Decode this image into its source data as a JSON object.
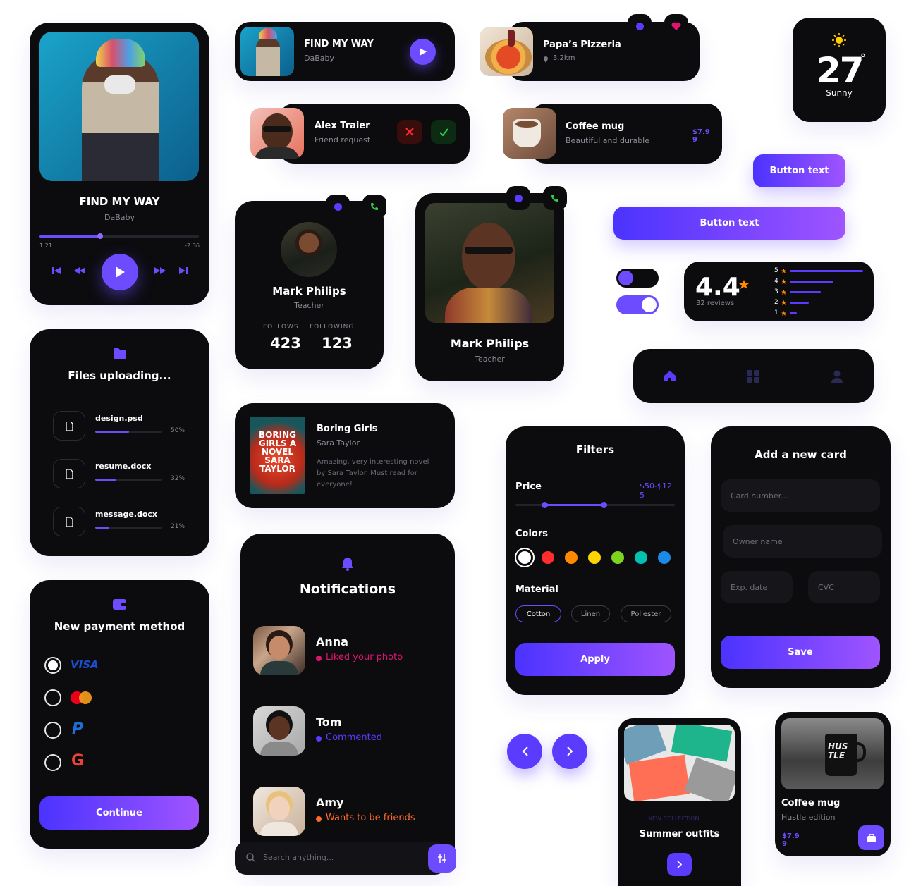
{
  "player": {
    "title": "FIND MY WAY",
    "artist": "DaBaby",
    "elapsed": "1:21",
    "remaining": "-2:36",
    "progress": 0.38
  },
  "mini_player": {
    "title": "FIND MY WAY",
    "artist": "DaBaby"
  },
  "pizzeria": {
    "name": "Papa’s Pizzeria",
    "distance": "3.2km"
  },
  "weather": {
    "temp": "27",
    "deg": "°",
    "condition": "Sunny"
  },
  "friend_request": {
    "name": "Alex Traier",
    "subtitle": "Friend request"
  },
  "coffee_row": {
    "name": "Coffee mug",
    "subtitle": "Beautiful and durable",
    "price": "$7.9\n9"
  },
  "buttons": {
    "small": "Button text",
    "wide": "Button text"
  },
  "profile_small": {
    "name": "Mark Philips",
    "role": "Teacher",
    "follows_label": "FOLLOWS",
    "follows": "423",
    "following_label": "FOLLOWING",
    "following": "123"
  },
  "profile_big": {
    "name": "Mark Philips",
    "role": "Teacher"
  },
  "toggles": [
    {
      "on": false
    },
    {
      "on": true
    }
  ],
  "rating": {
    "score": "4.4",
    "reviews": "32 reviews",
    "bars": [
      {
        "label": "5",
        "value": 1.0
      },
      {
        "label": "4",
        "value": 0.6
      },
      {
        "label": "3",
        "value": 0.42
      },
      {
        "label": "2",
        "value": 0.26
      },
      {
        "label": "1",
        "value": 0.1
      }
    ]
  },
  "files": {
    "title": "Files uploading...",
    "items": [
      {
        "name": "design.psd",
        "pct": "50%",
        "value": 0.5
      },
      {
        "name": "resume.docx",
        "pct": "32%",
        "value": 0.32
      },
      {
        "name": "message.docx",
        "pct": "21%",
        "value": 0.21
      }
    ]
  },
  "book": {
    "title": "Boring Girls",
    "author": "Sara Taylor",
    "desc": "Amazing, very interesting novel by Sara Taylor. Must read for everyone!",
    "cover_text": "BORING GIRLS A NOVEL SARA TAYLOR"
  },
  "filters": {
    "title": "Filters",
    "price_label": "Price",
    "price_value": "$50-$12\n5",
    "colors_label": "Colors",
    "colors": [
      "#ffffff",
      "#ff2d2d",
      "#ff8a00",
      "#ffd400",
      "#7ed321",
      "#00c2b2",
      "#1a8ae6"
    ],
    "material_label": "Material",
    "materials": [
      "Cotton",
      "Linen",
      "Poliester"
    ],
    "apply": "Apply"
  },
  "new_card": {
    "title": "Add a new card",
    "card_number": "Card number...",
    "owner": "Owner name",
    "exp": "Exp. date",
    "cvc": "CVC",
    "save": "Save"
  },
  "payment": {
    "title": "New payment method",
    "visa": "VISA",
    "continue": "Continue"
  },
  "notifications": {
    "title": "Notifications",
    "items": [
      {
        "name": "Anna",
        "action": "Liked your photo",
        "color": "#e0156f"
      },
      {
        "name": "Tom",
        "action": "Commented",
        "color": "#5b3cff"
      },
      {
        "name": "Amy",
        "action": "Wants to be friends",
        "color": "#ff6a2b"
      }
    ],
    "search_placeholder": "Search anything..."
  },
  "summer": {
    "tag": "NEW COLLECTION",
    "title": "Summer outfits"
  },
  "coffee_card": {
    "name": "Coffee mug",
    "subtitle": "Hustle edition",
    "price": "$7.9\n9",
    "mug_text": "HUS TLE"
  }
}
